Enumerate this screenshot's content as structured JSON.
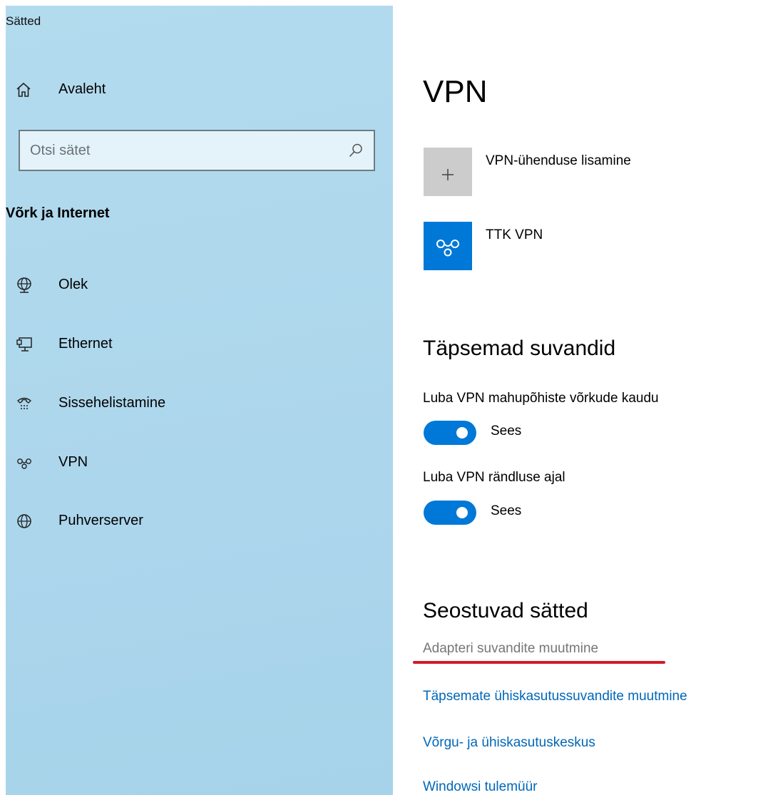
{
  "app": {
    "title": "Sätted"
  },
  "sidebar": {
    "home_label": "Avaleht",
    "search_placeholder": "Otsi sätet",
    "section_title": "Võrk ja Internet",
    "items": [
      {
        "label": "Olek",
        "icon": "status-globe-icon"
      },
      {
        "label": "Ethernet",
        "icon": "ethernet-icon"
      },
      {
        "label": "Sissehelistamine",
        "icon": "dialup-icon"
      },
      {
        "label": "VPN",
        "icon": "vpn-icon"
      },
      {
        "label": "Puhverserver",
        "icon": "globe-icon"
      }
    ]
  },
  "main": {
    "title": "VPN",
    "add_vpn_label": "VPN-ühenduse lisamine",
    "connections": [
      {
        "name": "TTK VPN"
      }
    ],
    "advanced": {
      "title": "Täpsemad suvandid",
      "options": [
        {
          "label": "Luba VPN mahupõhiste võrkude kaudu",
          "state": "Sees",
          "on": true
        },
        {
          "label": "Luba VPN rändluse ajal",
          "state": "Sees",
          "on": true
        }
      ]
    },
    "related": {
      "title": "Seostuvad sätted",
      "links": [
        "Adapteri suvandite muutmine",
        "Täpsemate ühiskasutussuvandite muutmine",
        "Võrgu- ja ühiskasutuskeskus",
        "Windowsi tulemüür"
      ]
    }
  },
  "colors": {
    "accent": "#0078d7",
    "link": "#0067b8",
    "sidebar_bg": "#acd6ec",
    "highlight_underline": "#d01c28"
  }
}
